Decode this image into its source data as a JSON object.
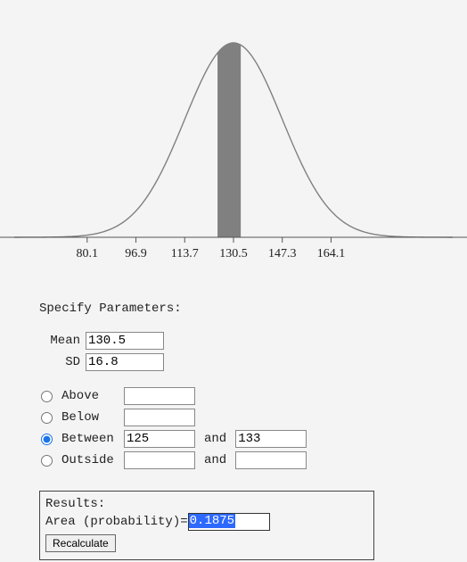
{
  "chart_data": {
    "type": "area",
    "title": "",
    "distribution": "normal",
    "mean": 130.5,
    "sd": 16.8,
    "x_range": [
      55,
      206
    ],
    "shaded_region": {
      "kind": "between",
      "from": 125,
      "to": 133
    },
    "area_probability": 0.1875,
    "axis_ticks": [
      80.1,
      96.9,
      113.7,
      130.5,
      147.3,
      164.1
    ],
    "xlabel": "",
    "ylabel": ""
  },
  "form": {
    "specify_title": "Specify Parameters:",
    "mean_label": "Mean",
    "sd_label": "SD",
    "mean_value": "130.5",
    "sd_value": "16.8",
    "modes": {
      "above": {
        "label": "Above",
        "a": "",
        "b": ""
      },
      "below": {
        "label": "Below",
        "a": "",
        "b": ""
      },
      "between": {
        "label": "Between",
        "a": "125",
        "b": "133"
      },
      "outside": {
        "label": "Outside",
        "a": "",
        "b": ""
      },
      "selected": "between",
      "and_label": "and"
    },
    "results": {
      "title": "Results:",
      "area_label": "Area (probability)",
      "equals": " = ",
      "value": "0.1875",
      "recalc_label": "Recalculate"
    }
  }
}
